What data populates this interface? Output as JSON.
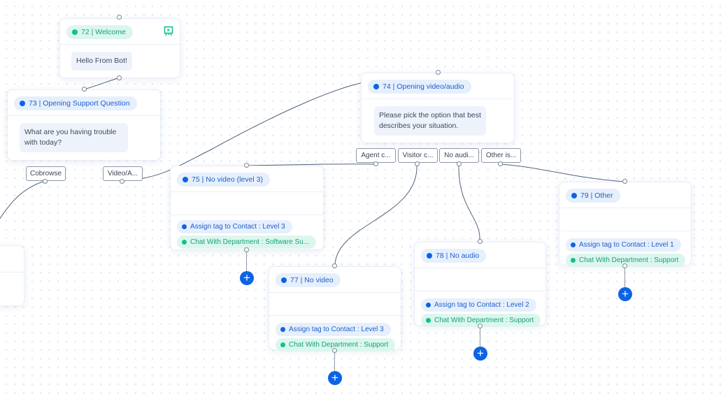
{
  "canvas": {
    "background": "#ffffff",
    "accent_blue": "#0b63e5",
    "accent_green": "#13c08c"
  },
  "nodes": {
    "n72": {
      "label": "72 | Welcome",
      "color": "green",
      "icon": "presentation-preview-icon",
      "message": "Hello From Bot!"
    },
    "n73": {
      "label": "73 | Opening Support Question",
      "color": "blue",
      "message": "What are you having trouble with today?",
      "options": [
        "Cobrowse",
        "Video/A..."
      ]
    },
    "n74": {
      "label": "74 | Opening video/audio",
      "color": "blue",
      "message": "Please pick the option that best describes your situation.",
      "options": [
        "Agent c...",
        "Visitor c...",
        "No audi...",
        "Other is..."
      ]
    },
    "n75": {
      "label": "75 | No video (level 3)",
      "color": "blue",
      "actions": [
        {
          "text": "Assign tag to Contact : Level 3",
          "color": "blue"
        },
        {
          "text": "Chat With Department : Software Su...",
          "color": "green"
        }
      ]
    },
    "n77": {
      "label": "77 | No video",
      "color": "blue",
      "actions": [
        {
          "text": "Assign tag to Contact : Level 3",
          "color": "blue"
        },
        {
          "text": "Chat With Department : Support",
          "color": "green"
        }
      ]
    },
    "n78": {
      "label": "78 | No audio",
      "color": "blue",
      "actions": [
        {
          "text": "Assign tag to Contact : Level 2",
          "color": "blue"
        },
        {
          "text": "Chat With Department : Support",
          "color": "green"
        }
      ]
    },
    "n79": {
      "label": "79 | Other",
      "color": "blue",
      "actions": [
        {
          "text": "Assign tag to Contact : Level 1",
          "color": "blue"
        },
        {
          "text": "Chat With Department : Support",
          "color": "green"
        }
      ]
    }
  },
  "add_button": {
    "label": "+"
  }
}
